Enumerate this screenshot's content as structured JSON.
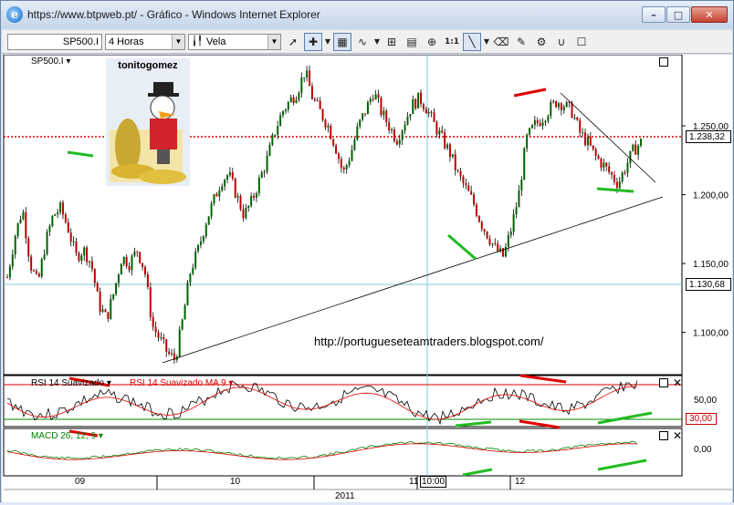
{
  "window": {
    "title": "https://www.btpweb.pt/ - Gráfico - Windows Internet Explorer",
    "controls": [
      "–",
      "□",
      "✕"
    ]
  },
  "toolbar": {
    "symbol": "SP500.I",
    "timeframe": "4 Horas",
    "chart_type": "Vela"
  },
  "chart": {
    "symbol_label": "SP500.I ▾",
    "author": "tonitogomez",
    "watermark_url": "http://portugueseteamtraders.blogspot.com/",
    "current_price": "1.238,32",
    "cursor_price": "1.130,68",
    "rsi_label": "RSI 14 Suavizado ▾",
    "rsi_ma_label": "RSI 14 Suavizado MA 9 ▾",
    "rsi_value": "30,00",
    "rsi_tick": "50,00",
    "macd_label": "MACD 26, 12, 9 ▾",
    "macd_tick": "0,00",
    "x_labels": [
      "09",
      "10",
      "11",
      "12"
    ],
    "x_cursor": "10:00",
    "year": "2011",
    "colors": {
      "up": "#006400",
      "down": "#c00000",
      "rsi_line": "#000000",
      "rsi_ma": "#e00000",
      "macd": "#008000",
      "trend_red": "#e00000",
      "trend_green": "#22bb22"
    }
  },
  "chart_data": {
    "type": "candlestick",
    "y_ticks": [
      "1.250,00",
      "1.200,00",
      "1.150,00",
      "1.100,00"
    ],
    "ylim": [
      1070,
      1295
    ],
    "price_path": [
      1140,
      1170,
      1190,
      1150,
      1135,
      1165,
      1185,
      1190,
      1175,
      1155,
      1160,
      1150,
      1120,
      1110,
      1130,
      1155,
      1150,
      1160,
      1145,
      1105,
      1095,
      1085,
      1080,
      1110,
      1145,
      1160,
      1180,
      1195,
      1210,
      1215,
      1200,
      1185,
      1195,
      1210,
      1225,
      1245,
      1260,
      1268,
      1275,
      1290,
      1270,
      1260,
      1250,
      1235,
      1215,
      1230,
      1250,
      1262,
      1275,
      1260,
      1250,
      1240,
      1252,
      1265,
      1270,
      1262,
      1250,
      1240,
      1230,
      1215,
      1205,
      1195,
      1180,
      1170,
      1160,
      1155,
      1175,
      1200,
      1240,
      1250,
      1255,
      1262,
      1268,
      1265,
      1260,
      1245,
      1238,
      1228,
      1222,
      1215,
      1208,
      1220,
      1232,
      1238
    ]
  }
}
